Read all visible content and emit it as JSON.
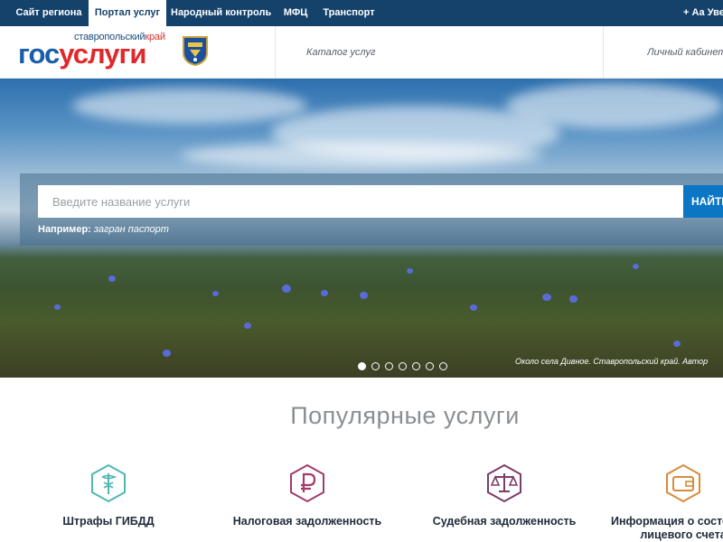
{
  "topnav": {
    "tabs": [
      {
        "label": "Сайт региона",
        "active": false
      },
      {
        "label": "Портал услуг",
        "active": true
      },
      {
        "label": "Народный контроль",
        "active": false
      },
      {
        "label": "МФЦ",
        "active": false
      },
      {
        "label": "Транспорт",
        "active": false
      }
    ],
    "accessibility_label": "+ Аа Увеличить"
  },
  "header": {
    "logo": {
      "region_main": "ставропольский",
      "region_accent": "край",
      "mark_blue": "гос",
      "mark_red": "услуги"
    },
    "catalog_label": "Каталог услуг",
    "cabinet_label": "Личный кабинет"
  },
  "hero": {
    "search": {
      "placeholder": "Введите название услуги",
      "button_label": "НАЙТИ",
      "hint_label": "Например:",
      "hint_example": "загран паспорт"
    },
    "caption": "Около села Дивное. Ставропольский край. Автор",
    "slides_total": 7,
    "active_slide": 1
  },
  "popular": {
    "title": "Популярные услуги",
    "services": [
      {
        "label": "Штрафы ГИБДД",
        "icon": "caduceus-icon",
        "color": "#4fb7b4"
      },
      {
        "label": "Налоговая задолженность",
        "icon": "ruble-icon",
        "color": "#a43b6a"
      },
      {
        "label": "Судебная задолженность",
        "icon": "scales-icon",
        "color": "#7a3d6e"
      },
      {
        "label": "Информация о состоянии\nлицевого счета",
        "icon": "wallet-icon",
        "color": "#d98a3a"
      }
    ]
  },
  "colors": {
    "topbar_bg": "#14426a",
    "search_button": "#0b77c4",
    "logo_blue": "#1a5ea8",
    "logo_red": "#e0292b"
  }
}
